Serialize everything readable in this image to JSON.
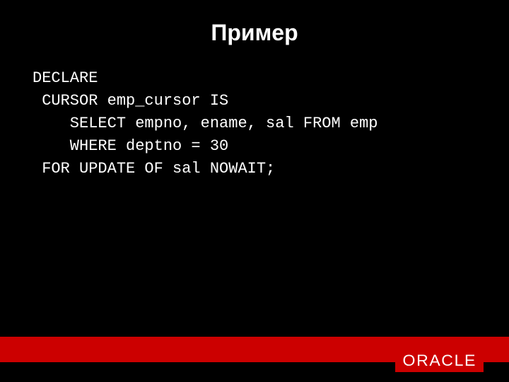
{
  "title": "Пример",
  "code": {
    "line1": "DECLARE",
    "line2": " CURSOR emp_cursor IS",
    "line3": "    SELECT empno, ename, sal FROM emp",
    "line4": "    WHERE deptno = 30",
    "line5": " FOR UPDATE OF sal NOWAIT;"
  },
  "logo": "ORACLE"
}
